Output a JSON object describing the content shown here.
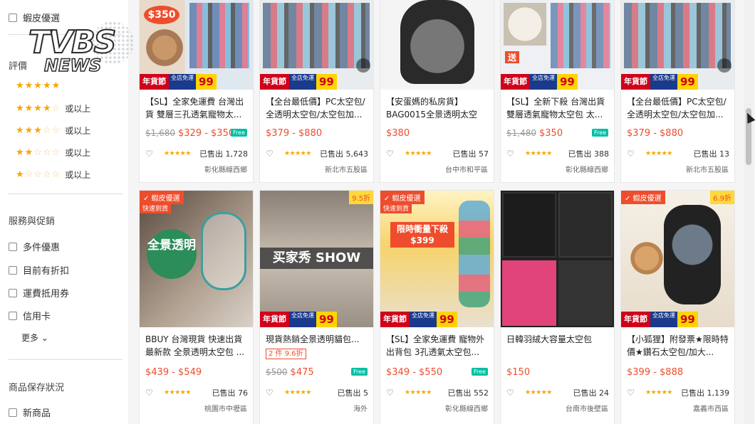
{
  "sidebar": {
    "shopee_pick": "蝦皮優選",
    "rating_heading": "評價",
    "rating_rows": [
      {
        "stars": "★★★★★",
        "off": "",
        "text": ""
      },
      {
        "stars": "★★★★",
        "off": "☆",
        "text": "或以上"
      },
      {
        "stars": "★★★",
        "off": "☆☆",
        "text": "或以上"
      },
      {
        "stars": "★★",
        "off": "☆☆☆",
        "text": "或以上"
      },
      {
        "stars": "★",
        "off": "☆☆☆☆",
        "text": "或以上"
      }
    ],
    "service_heading": "服務與促銷",
    "service_items": [
      "多件優惠",
      "目前有折扣",
      "運費抵用券",
      "信用卡"
    ],
    "more_label": "更多",
    "condition_heading": "商品保存狀況",
    "condition_items": [
      "新商品"
    ]
  },
  "watermark": {
    "line1": "TVBS",
    "line2": "NEWS"
  },
  "products": [
    {
      "title": "【SL】全家免運費 台灣出貨 雙層三孔透氣寵物太...",
      "old_price": "$1,680",
      "price": "$329 - $350",
      "free": true,
      "sold": "已售出 1,728",
      "location": "彰化縣線西鄉",
      "thumb_label": "$350",
      "banner": true
    },
    {
      "title": "【全台最低價】PC太空包/全透明太空包/太空包加...",
      "old_price": "",
      "price": "$379 - $880",
      "free": false,
      "sold": "已售出 5,643",
      "location": "新北市五股區",
      "thumb_label": "",
      "banner": true
    },
    {
      "title": "【安蛋媽的私房貨】BAG0015全景透明太空包...",
      "old_price": "",
      "price": "$380",
      "free": false,
      "sold": "已售出 57",
      "location": "台中市和平區",
      "thumb_label": "",
      "banner": false
    },
    {
      "title": "【SL】全新下殺 台灣出貨 雙層透氣寵物太空包 太...",
      "old_price": "$1,480",
      "price": "$350",
      "free": true,
      "sold": "已售出 388",
      "location": "彰化縣線西鄉",
      "thumb_label": "送",
      "banner": true
    },
    {
      "title": "【全台最低價】PC太空包/全透明太空包/太空包加...",
      "old_price": "",
      "price": "$379 - $880",
      "free": false,
      "sold": "已售出 13",
      "location": "新北市五股區",
      "thumb_label": "",
      "banner": true
    },
    {
      "title": "BBUY 台灣現貨 快速出貨 最新款 全景透明太空包 ...",
      "old_price": "",
      "price": "$439 - $549",
      "free": false,
      "sold": "已售出 76",
      "location": "桃園市中壢區",
      "thumb_label": "全景透明",
      "ribbon": "✓ 蝦皮優選",
      "ribbon2": "快速到貨",
      "banner": false
    },
    {
      "title": "現貨熱銷全景透明貓包...",
      "old_price": "$500",
      "price": "$475",
      "free": true,
      "sold": "已售出 5",
      "location": "海外",
      "thumb_label": "买家秀 SHOW",
      "promo": "2 件 9.6折",
      "disc": "9.5折",
      "banner": true
    },
    {
      "title": "【SL】全家免運費 寵物外出背包 3孔透氣太空包...",
      "old_price": "",
      "price": "$349 - $550",
      "free": true,
      "sold": "已售出 552",
      "location": "彰化縣線西鄉",
      "thumb_label": "限時衝量下殺 $399",
      "ribbon": "✓ 蝦皮優選",
      "ribbon2": "快速到貨",
      "banner": true
    },
    {
      "title": "日韓羽絨大容量太空包",
      "old_price": "",
      "price": "$150",
      "free": false,
      "sold": "已售出 24",
      "location": "台南市後壁區",
      "thumb_label": "",
      "banner": false
    },
    {
      "title": "【小狐狸】附發票★限時特價★鑽石太空包/加大...",
      "old_price": "",
      "price": "$399 - $888",
      "free": false,
      "sold": "已售出 1,139",
      "location": "嘉義市西區",
      "thumb_label": "",
      "ribbon": "✓ 蝦皮優選",
      "disc": "6.9折",
      "banner": true
    }
  ],
  "banner": {
    "red": "年貨節",
    "blue": "全店免運",
    "yellow": "99"
  },
  "colors": {
    "accent": "#ee4d2d",
    "star": "#f6a700",
    "free": "#00bfa5"
  }
}
